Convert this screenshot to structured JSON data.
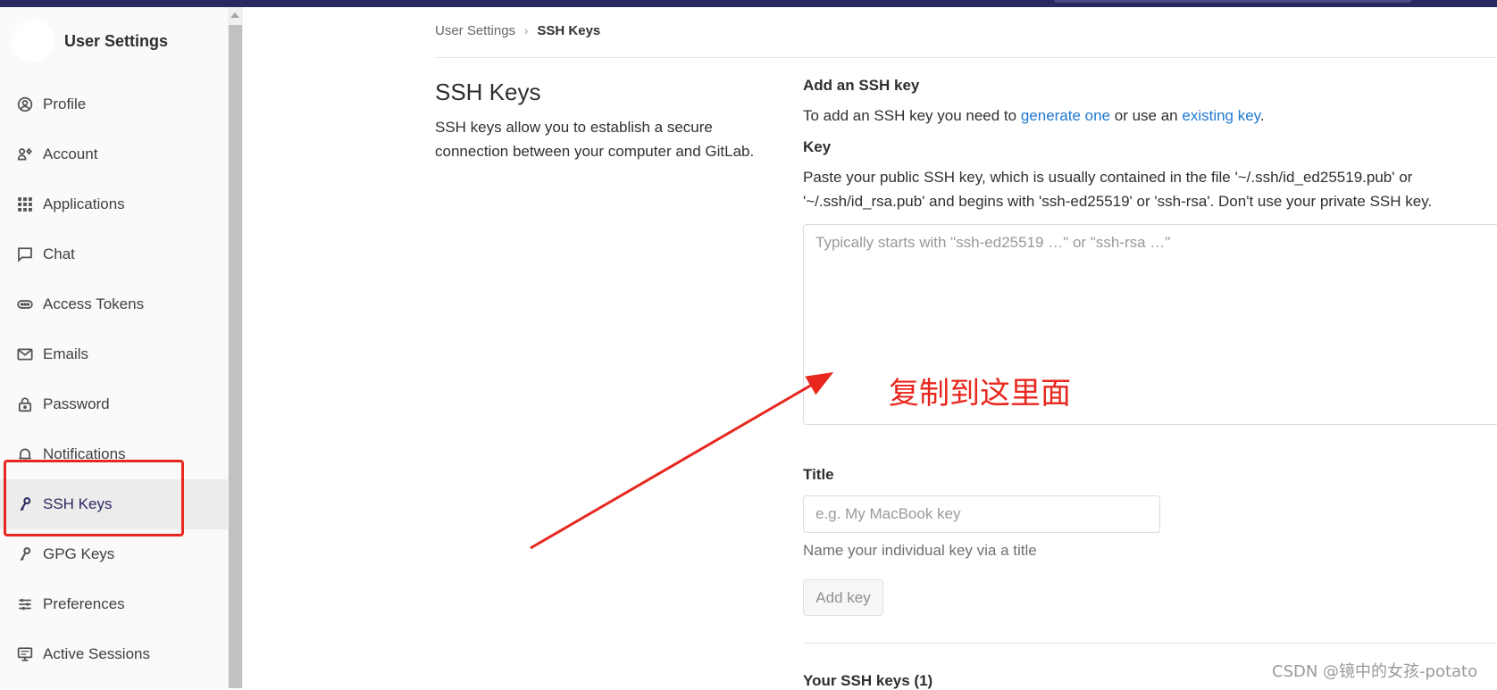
{
  "sidebar": {
    "title": "User Settings",
    "items": [
      {
        "label": "Profile",
        "icon": "profile-icon"
      },
      {
        "label": "Account",
        "icon": "account-icon"
      },
      {
        "label": "Applications",
        "icon": "applications-icon"
      },
      {
        "label": "Chat",
        "icon": "chat-icon"
      },
      {
        "label": "Access Tokens",
        "icon": "token-icon"
      },
      {
        "label": "Emails",
        "icon": "mail-icon"
      },
      {
        "label": "Password",
        "icon": "lock-icon"
      },
      {
        "label": "Notifications",
        "icon": "bell-icon"
      },
      {
        "label": "SSH Keys",
        "icon": "key-icon",
        "active": true
      },
      {
        "label": "GPG Keys",
        "icon": "key-icon"
      },
      {
        "label": "Preferences",
        "icon": "sliders-icon"
      },
      {
        "label": "Active Sessions",
        "icon": "monitor-icon"
      }
    ]
  },
  "breadcrumb": {
    "parent": "User Settings",
    "separator": "›",
    "current": "SSH Keys"
  },
  "main": {
    "title": "SSH Keys",
    "description": "SSH keys allow you to establish a secure connection between your computer and GitLab."
  },
  "add_key": {
    "heading": "Add an SSH key",
    "intro_prefix": "To add an SSH key you need to ",
    "link_generate": "generate one",
    "intro_middle": " or use an ",
    "link_existing": "existing key",
    "intro_suffix": ".",
    "key_label": "Key",
    "key_help": "Paste your public SSH key, which is usually contained in the file '~/.ssh/id_ed25519.pub' or '~/.ssh/id_rsa.pub' and begins with 'ssh-ed25519' or 'ssh-rsa'. Don't use your private SSH key.",
    "key_placeholder": "Typically starts with \"ssh-ed25519 …\" or \"ssh-rsa …\"",
    "title_label": "Title",
    "title_placeholder": "e.g. My MacBook key",
    "title_hint": "Name your individual key via a title",
    "add_button": "Add key",
    "your_keys": "Your SSH keys (1)"
  },
  "annotation": {
    "text": "复制到这里面",
    "color": "#e8271e"
  },
  "watermark": "CSDN @镜中的女孩-potato",
  "colors": {
    "topbar": "#292961",
    "link": "#1f78d1",
    "active_nav": "#292961"
  }
}
